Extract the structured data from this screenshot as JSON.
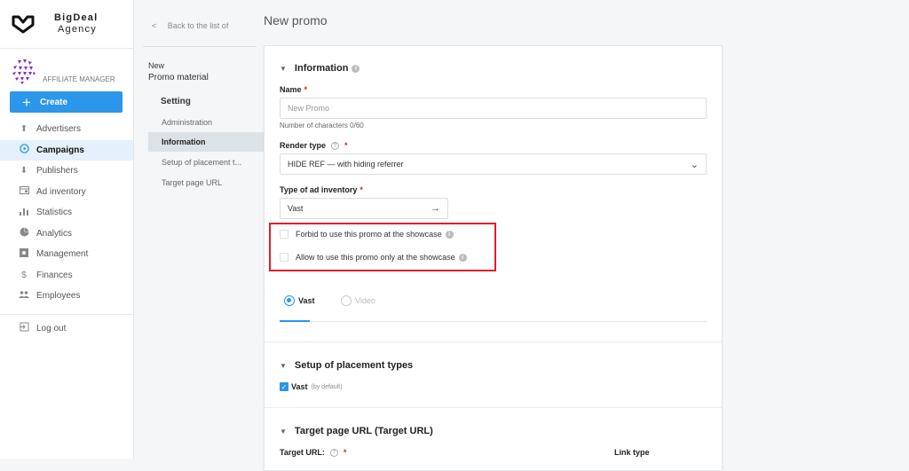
{
  "brand": {
    "name_line1": "BigDeal",
    "name_line2": "Agency"
  },
  "sidebar": {
    "role": "AFFILIATE MANAGER",
    "create_label": "Create",
    "items": [
      {
        "label": "Advertisers",
        "icon": "upload-icon",
        "glyph": "⬆"
      },
      {
        "label": "Campaigns",
        "icon": "play-circle-icon",
        "glyph": "▶",
        "active": true
      },
      {
        "label": "Publishers",
        "icon": "download-icon",
        "glyph": "⬇"
      },
      {
        "label": "Ad inventory",
        "icon": "ad-inventory-icon",
        "glyph": "▭"
      },
      {
        "label": "Statistics",
        "icon": "bar-chart-icon",
        "glyph": "▮"
      },
      {
        "label": "Analytics",
        "icon": "pie-chart-icon",
        "glyph": "◕"
      },
      {
        "label": "Management",
        "icon": "management-icon",
        "glyph": "▣"
      },
      {
        "label": "Finances",
        "icon": "dollar-icon",
        "glyph": "$"
      },
      {
        "label": "Employees",
        "icon": "people-icon",
        "glyph": "👥"
      }
    ],
    "logout_label": "Log out"
  },
  "subpanel": {
    "back_label": "Back to the list of",
    "new_label": "New",
    "title": "Promo material",
    "setting_label": "Setting",
    "items": [
      {
        "label": "Administration"
      },
      {
        "label": "Information",
        "active": true
      },
      {
        "label": "Setup of placement t..."
      },
      {
        "label": "Target page URL"
      }
    ]
  },
  "main": {
    "page_title": "New promo",
    "information": {
      "title": "Information",
      "name_label": "Name",
      "name_placeholder": "New Promo",
      "name_hint": "Number of characters 0/60",
      "render_type_label": "Render type",
      "render_type_value": "HIDE REF — with hiding referrer",
      "ad_inventory_label": "Type of ad inventory",
      "ad_inventory_value": "Vast",
      "checkboxes": [
        {
          "label": "Forbid to use this promo at the showcase",
          "checked": false
        },
        {
          "label": "Allow to use this promo only at the showcase",
          "checked": false
        }
      ],
      "tabs": [
        {
          "label": "Vast",
          "selected": true
        },
        {
          "label": "Video",
          "selected": false
        }
      ]
    },
    "placement": {
      "title": "Setup of placement types",
      "option_label": "Vast",
      "option_note": "(by default)",
      "checked": true
    },
    "target": {
      "title": "Target page URL (Target URL)",
      "url_label": "Target URL:",
      "link_type_label": "Link type"
    }
  }
}
